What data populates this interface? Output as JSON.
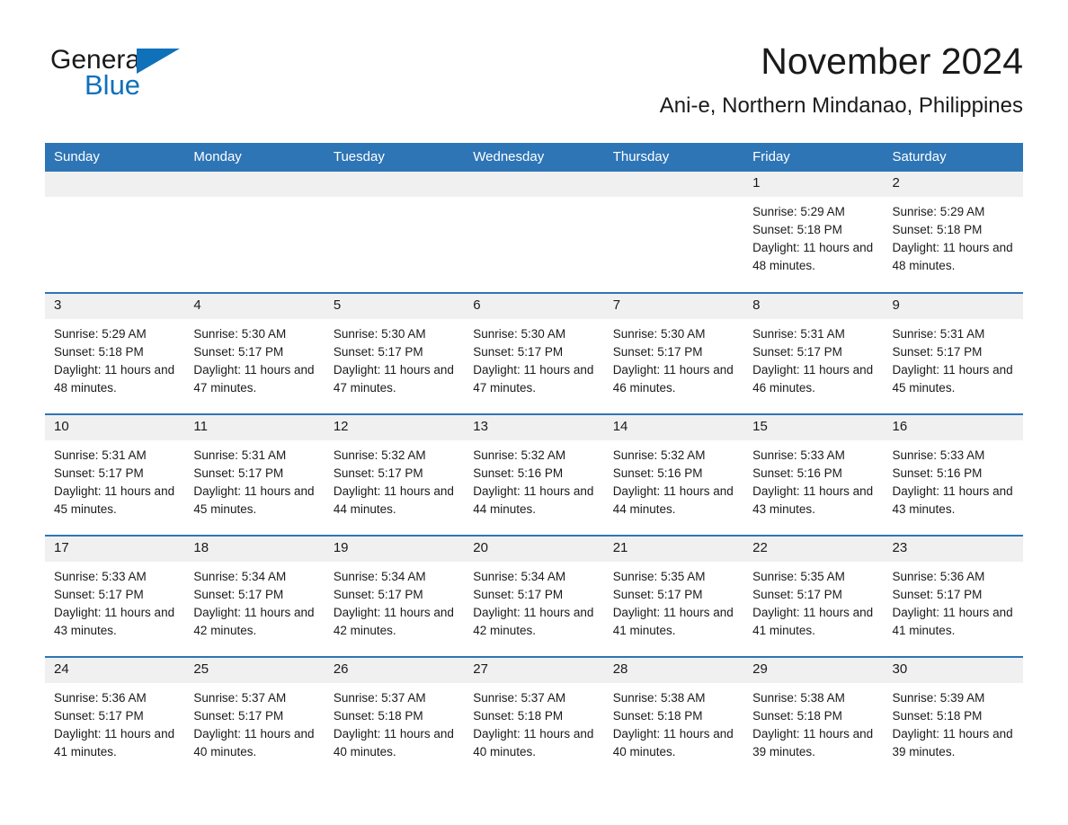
{
  "brand": {
    "name_top": "General",
    "name_bottom": "Blue",
    "triangle_icon": "triangle-icon",
    "accent_color": "#1071bb"
  },
  "header": {
    "month_title": "November 2024",
    "location": "Ani-e, Northern Mindanao, Philippines"
  },
  "calendar": {
    "header_bg": "#2e75b6",
    "date_strip_bg": "#f0f0f0",
    "weekday_headers": [
      "Sunday",
      "Monday",
      "Tuesday",
      "Wednesday",
      "Thursday",
      "Friday",
      "Saturday"
    ],
    "weeks": [
      [
        {
          "day": "",
          "sunrise": "",
          "sunset": "",
          "daylight": ""
        },
        {
          "day": "",
          "sunrise": "",
          "sunset": "",
          "daylight": ""
        },
        {
          "day": "",
          "sunrise": "",
          "sunset": "",
          "daylight": ""
        },
        {
          "day": "",
          "sunrise": "",
          "sunset": "",
          "daylight": ""
        },
        {
          "day": "",
          "sunrise": "",
          "sunset": "",
          "daylight": ""
        },
        {
          "day": "1",
          "sunrise": "Sunrise: 5:29 AM",
          "sunset": "Sunset: 5:18 PM",
          "daylight": "Daylight: 11 hours and 48 minutes."
        },
        {
          "day": "2",
          "sunrise": "Sunrise: 5:29 AM",
          "sunset": "Sunset: 5:18 PM",
          "daylight": "Daylight: 11 hours and 48 minutes."
        }
      ],
      [
        {
          "day": "3",
          "sunrise": "Sunrise: 5:29 AM",
          "sunset": "Sunset: 5:18 PM",
          "daylight": "Daylight: 11 hours and 48 minutes."
        },
        {
          "day": "4",
          "sunrise": "Sunrise: 5:30 AM",
          "sunset": "Sunset: 5:17 PM",
          "daylight": "Daylight: 11 hours and 47 minutes."
        },
        {
          "day": "5",
          "sunrise": "Sunrise: 5:30 AM",
          "sunset": "Sunset: 5:17 PM",
          "daylight": "Daylight: 11 hours and 47 minutes."
        },
        {
          "day": "6",
          "sunrise": "Sunrise: 5:30 AM",
          "sunset": "Sunset: 5:17 PM",
          "daylight": "Daylight: 11 hours and 47 minutes."
        },
        {
          "day": "7",
          "sunrise": "Sunrise: 5:30 AM",
          "sunset": "Sunset: 5:17 PM",
          "daylight": "Daylight: 11 hours and 46 minutes."
        },
        {
          "day": "8",
          "sunrise": "Sunrise: 5:31 AM",
          "sunset": "Sunset: 5:17 PM",
          "daylight": "Daylight: 11 hours and 46 minutes."
        },
        {
          "day": "9",
          "sunrise": "Sunrise: 5:31 AM",
          "sunset": "Sunset: 5:17 PM",
          "daylight": "Daylight: 11 hours and 45 minutes."
        }
      ],
      [
        {
          "day": "10",
          "sunrise": "Sunrise: 5:31 AM",
          "sunset": "Sunset: 5:17 PM",
          "daylight": "Daylight: 11 hours and 45 minutes."
        },
        {
          "day": "11",
          "sunrise": "Sunrise: 5:31 AM",
          "sunset": "Sunset: 5:17 PM",
          "daylight": "Daylight: 11 hours and 45 minutes."
        },
        {
          "day": "12",
          "sunrise": "Sunrise: 5:32 AM",
          "sunset": "Sunset: 5:17 PM",
          "daylight": "Daylight: 11 hours and 44 minutes."
        },
        {
          "day": "13",
          "sunrise": "Sunrise: 5:32 AM",
          "sunset": "Sunset: 5:16 PM",
          "daylight": "Daylight: 11 hours and 44 minutes."
        },
        {
          "day": "14",
          "sunrise": "Sunrise: 5:32 AM",
          "sunset": "Sunset: 5:16 PM",
          "daylight": "Daylight: 11 hours and 44 minutes."
        },
        {
          "day": "15",
          "sunrise": "Sunrise: 5:33 AM",
          "sunset": "Sunset: 5:16 PM",
          "daylight": "Daylight: 11 hours and 43 minutes."
        },
        {
          "day": "16",
          "sunrise": "Sunrise: 5:33 AM",
          "sunset": "Sunset: 5:16 PM",
          "daylight": "Daylight: 11 hours and 43 minutes."
        }
      ],
      [
        {
          "day": "17",
          "sunrise": "Sunrise: 5:33 AM",
          "sunset": "Sunset: 5:17 PM",
          "daylight": "Daylight: 11 hours and 43 minutes."
        },
        {
          "day": "18",
          "sunrise": "Sunrise: 5:34 AM",
          "sunset": "Sunset: 5:17 PM",
          "daylight": "Daylight: 11 hours and 42 minutes."
        },
        {
          "day": "19",
          "sunrise": "Sunrise: 5:34 AM",
          "sunset": "Sunset: 5:17 PM",
          "daylight": "Daylight: 11 hours and 42 minutes."
        },
        {
          "day": "20",
          "sunrise": "Sunrise: 5:34 AM",
          "sunset": "Sunset: 5:17 PM",
          "daylight": "Daylight: 11 hours and 42 minutes."
        },
        {
          "day": "21",
          "sunrise": "Sunrise: 5:35 AM",
          "sunset": "Sunset: 5:17 PM",
          "daylight": "Daylight: 11 hours and 41 minutes."
        },
        {
          "day": "22",
          "sunrise": "Sunrise: 5:35 AM",
          "sunset": "Sunset: 5:17 PM",
          "daylight": "Daylight: 11 hours and 41 minutes."
        },
        {
          "day": "23",
          "sunrise": "Sunrise: 5:36 AM",
          "sunset": "Sunset: 5:17 PM",
          "daylight": "Daylight: 11 hours and 41 minutes."
        }
      ],
      [
        {
          "day": "24",
          "sunrise": "Sunrise: 5:36 AM",
          "sunset": "Sunset: 5:17 PM",
          "daylight": "Daylight: 11 hours and 41 minutes."
        },
        {
          "day": "25",
          "sunrise": "Sunrise: 5:37 AM",
          "sunset": "Sunset: 5:17 PM",
          "daylight": "Daylight: 11 hours and 40 minutes."
        },
        {
          "day": "26",
          "sunrise": "Sunrise: 5:37 AM",
          "sunset": "Sunset: 5:18 PM",
          "daylight": "Daylight: 11 hours and 40 minutes."
        },
        {
          "day": "27",
          "sunrise": "Sunrise: 5:37 AM",
          "sunset": "Sunset: 5:18 PM",
          "daylight": "Daylight: 11 hours and 40 minutes."
        },
        {
          "day": "28",
          "sunrise": "Sunrise: 5:38 AM",
          "sunset": "Sunset: 5:18 PM",
          "daylight": "Daylight: 11 hours and 40 minutes."
        },
        {
          "day": "29",
          "sunrise": "Sunrise: 5:38 AM",
          "sunset": "Sunset: 5:18 PM",
          "daylight": "Daylight: 11 hours and 39 minutes."
        },
        {
          "day": "30",
          "sunrise": "Sunrise: 5:39 AM",
          "sunset": "Sunset: 5:18 PM",
          "daylight": "Daylight: 11 hours and 39 minutes."
        }
      ]
    ]
  }
}
